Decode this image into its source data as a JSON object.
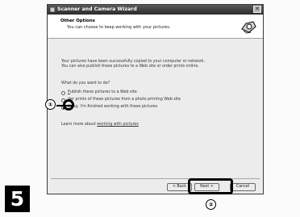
{
  "window": {
    "title": "Scanner and Camera Wizard",
    "close_symbol": "✕"
  },
  "header": {
    "title": "Other Options",
    "subtitle": "You can choose to keep working with your pictures.",
    "icon": "camera-icon"
  },
  "body": {
    "intro_line1": "Your pictures have been successfully copied to your computer or network.",
    "intro_line2": "You can also publish these pictures to a Web site or order prints online.",
    "question": "What do you want to do?",
    "options": [
      {
        "label_prefix": "",
        "label_underlined": "P",
        "label_rest": "ublish these pictures to a Web site",
        "checked": false
      },
      {
        "label_prefix": "",
        "label_underlined": "",
        "label_rest": "der prints of these pictures from a photo printing Web site",
        "checked": false
      },
      {
        "label_prefix": "",
        "label_underlined": "",
        "label_rest": "thing. I'm finished working with these pictures",
        "checked": true
      }
    ],
    "learn_more_prefix": "Learn more about ",
    "learn_more_link": "working with pictures"
  },
  "buttons": {
    "back": "< Back",
    "next": "Next >",
    "cancel": "Cancel"
  },
  "annotations": {
    "marker1": "①",
    "marker2": "②",
    "step_number": "5"
  },
  "colors": {
    "titlebar": "#2b2b2b",
    "window_bg": "#ececec",
    "annotation": "#000000"
  }
}
